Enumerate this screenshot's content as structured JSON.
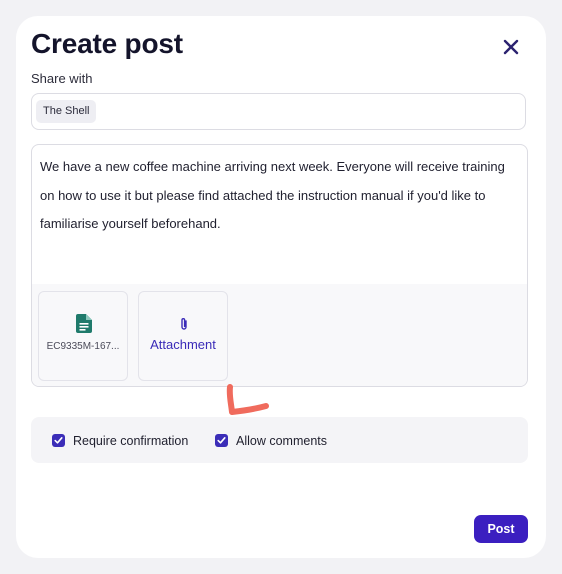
{
  "header": {
    "title": "Create post"
  },
  "share": {
    "label": "Share with",
    "chips": [
      "The Shell"
    ]
  },
  "post": {
    "body": "We have a new coffee machine arriving next week. Everyone will receive training on how to use it but please find attached the instruction manual if you'd like to familiarise yourself beforehand."
  },
  "attachments": {
    "files": [
      {
        "name": "EC9335M-167...",
        "icon": "file-document-icon"
      }
    ],
    "add_label": "Attachment",
    "add_icon": "paperclip-icon"
  },
  "options": {
    "require_confirmation": {
      "label": "Require confirmation",
      "checked": true
    },
    "allow_comments": {
      "label": "Allow comments",
      "checked": true
    }
  },
  "footer": {
    "post_label": "Post"
  },
  "colors": {
    "accent": "#3b1fc0",
    "checkbox": "#3b2db8",
    "file_icon": "#1f7a6b",
    "annotation": "#f06b5d"
  }
}
